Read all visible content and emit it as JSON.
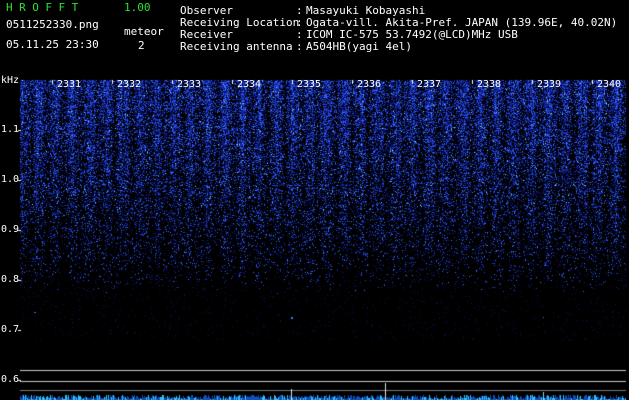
{
  "header": {
    "brand": "HROFFT",
    "version": "1.00",
    "filename": "0511252330.png",
    "datetime": "05.11.25 23:30",
    "meteor_label": "meteor",
    "meteor_count": "2"
  },
  "info": [
    {
      "key": "Observer",
      "value": "Masayuki Kobayashi"
    },
    {
      "key": "Receiving Location",
      "value": "Ogata-vill. Akita-Pref. JAPAN (139.96E, 40.02N)"
    },
    {
      "key": "Receiver",
      "value": "ICOM IC-575 53.7492(@LCD)MHz USB"
    },
    {
      "key": "Receiving antenna",
      "value": "A504HB(yagi 4el)"
    }
  ],
  "plot": {
    "y_unit": "kHz",
    "y_ticks": [
      "1.1",
      "1.0",
      "0.9",
      "0.8",
      "0.7",
      "0.6"
    ],
    "time_ticks": [
      "2331",
      "2332",
      "2333",
      "2334",
      "2335",
      "2336",
      "2337",
      "2338",
      "2339",
      "2340"
    ],
    "colors": {
      "background": "#000000",
      "signal": "#2040ff",
      "highlight": "#80e0ff",
      "axis_lines": "#ffffff"
    }
  }
}
